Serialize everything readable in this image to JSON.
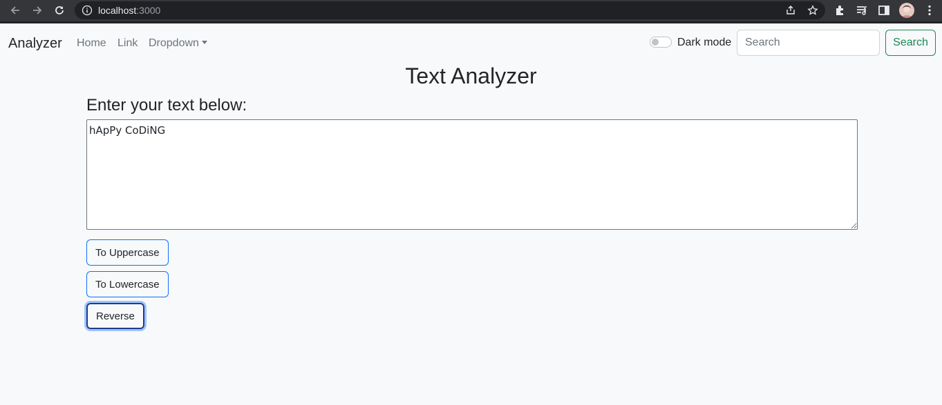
{
  "browser": {
    "host": "localhost",
    "port": ":3000"
  },
  "navbar": {
    "brand": "Analyzer",
    "links": [
      "Home",
      "Link",
      "Dropdown"
    ],
    "dark_mode_label": "Dark mode",
    "search_placeholder": "Search",
    "search_button": "Search"
  },
  "main": {
    "title": "Text Analyzer",
    "subtitle": "Enter your text below:",
    "text_value": "hApPy CoDiNG",
    "buttons": [
      "To Uppercase",
      "To Lowercase",
      "Reverse"
    ]
  },
  "colors": {
    "accent_primary": "#0d6efd",
    "accent_success": "#198754",
    "page_background": "#f8f9fa"
  }
}
